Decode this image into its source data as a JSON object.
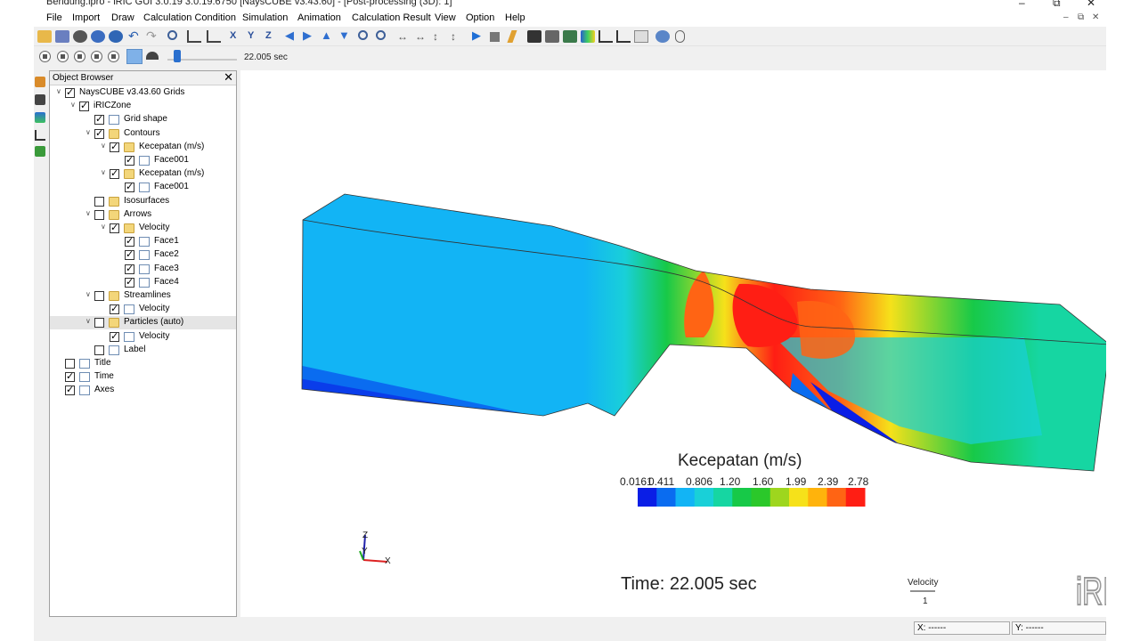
{
  "window": {
    "title": "Bendung.ipro - iRIC GUI 3.0.19 3.0.19.6750 [NaysCUBE v3.43.60] - [Post-processing (3D): 1]",
    "minimize": "–",
    "restore": "⧉",
    "close": "✕"
  },
  "menu": {
    "items": [
      "File",
      "Import",
      "Draw",
      "Calculation Condition",
      "Simulation",
      "Animation",
      "Calculation Result",
      "View",
      "Option",
      "Help"
    ],
    "mdi_minimize": "–",
    "mdi_restore": "⧉",
    "mdi_close": "✕"
  },
  "playback": {
    "time_label": "22.005 sec",
    "slider_fraction": 0.1
  },
  "object_browser": {
    "title": "Object Browser",
    "close": "✕",
    "tree": [
      {
        "label": "NaysCUBE v3.43.60 Grids",
        "depth": 0,
        "arrow": "∨",
        "checked": true,
        "icon": "none"
      },
      {
        "label": "iRICZone",
        "depth": 1,
        "arrow": "∨",
        "checked": true,
        "icon": "none"
      },
      {
        "label": "Grid shape",
        "depth": 2,
        "arrow": "",
        "checked": true,
        "icon": "file"
      },
      {
        "label": "Contours",
        "depth": 2,
        "arrow": "∨",
        "checked": true,
        "icon": "folder"
      },
      {
        "label": "Kecepatan (m/s)",
        "depth": 3,
        "arrow": "∨",
        "checked": true,
        "icon": "folder"
      },
      {
        "label": "Face001",
        "depth": 4,
        "arrow": "",
        "checked": true,
        "icon": "file"
      },
      {
        "label": "Kecepatan (m/s)",
        "depth": 3,
        "arrow": "∨",
        "checked": true,
        "icon": "folder"
      },
      {
        "label": "Face001",
        "depth": 4,
        "arrow": "",
        "checked": true,
        "icon": "file"
      },
      {
        "label": "Isosurfaces",
        "depth": 2,
        "arrow": "",
        "checked": false,
        "icon": "folder"
      },
      {
        "label": "Arrows",
        "depth": 2,
        "arrow": "∨",
        "checked": false,
        "icon": "folder"
      },
      {
        "label": "Velocity",
        "depth": 3,
        "arrow": "∨",
        "checked": true,
        "icon": "folder"
      },
      {
        "label": "Face1",
        "depth": 4,
        "arrow": "",
        "checked": true,
        "icon": "file"
      },
      {
        "label": "Face2",
        "depth": 4,
        "arrow": "",
        "checked": true,
        "icon": "file"
      },
      {
        "label": "Face3",
        "depth": 4,
        "arrow": "",
        "checked": true,
        "icon": "file"
      },
      {
        "label": "Face4",
        "depth": 4,
        "arrow": "",
        "checked": true,
        "icon": "file"
      },
      {
        "label": "Streamlines",
        "depth": 2,
        "arrow": "∨",
        "checked": false,
        "icon": "folder"
      },
      {
        "label": "Velocity",
        "depth": 3,
        "arrow": "",
        "checked": true,
        "icon": "file"
      },
      {
        "label": "Particles (auto)",
        "depth": 2,
        "arrow": "∨",
        "checked": false,
        "icon": "folder",
        "selected": true
      },
      {
        "label": "Velocity",
        "depth": 3,
        "arrow": "",
        "checked": true,
        "icon": "file"
      },
      {
        "label": "Label",
        "depth": 2,
        "arrow": "",
        "checked": false,
        "icon": "file"
      },
      {
        "label": "Title",
        "depth": 0,
        "arrow": "",
        "checked": false,
        "icon": "file"
      },
      {
        "label": "Time",
        "depth": 0,
        "arrow": "",
        "checked": true,
        "icon": "file"
      },
      {
        "label": "Axes",
        "depth": 0,
        "arrow": "",
        "checked": true,
        "icon": "file"
      }
    ]
  },
  "viewport": {
    "legend_title": "Kecepatan (m/s)",
    "legend_ticks": [
      "0.0161",
      "0.411",
      "0.806",
      "1.20",
      "1.60",
      "1.99",
      "2.39",
      "2.78"
    ],
    "colormap": [
      "#0a1ee6",
      "#0a6cf0",
      "#12b4f5",
      "#19d0d8",
      "#16d6a2",
      "#17c948",
      "#2bc82a",
      "#9ed61e",
      "#f6e11a",
      "#ffb30c",
      "#ff6414",
      "#ff1e14"
    ],
    "time_text": "Time: 22.005 sec",
    "velocity_label": "Velocity",
    "velocity_scale": "1",
    "axis_x": "X",
    "axis_y": "Y",
    "axis_z": "Z",
    "logo_text": "iRIC"
  },
  "status": {
    "x_label": "X: ------",
    "y_label": "Y: ------"
  }
}
